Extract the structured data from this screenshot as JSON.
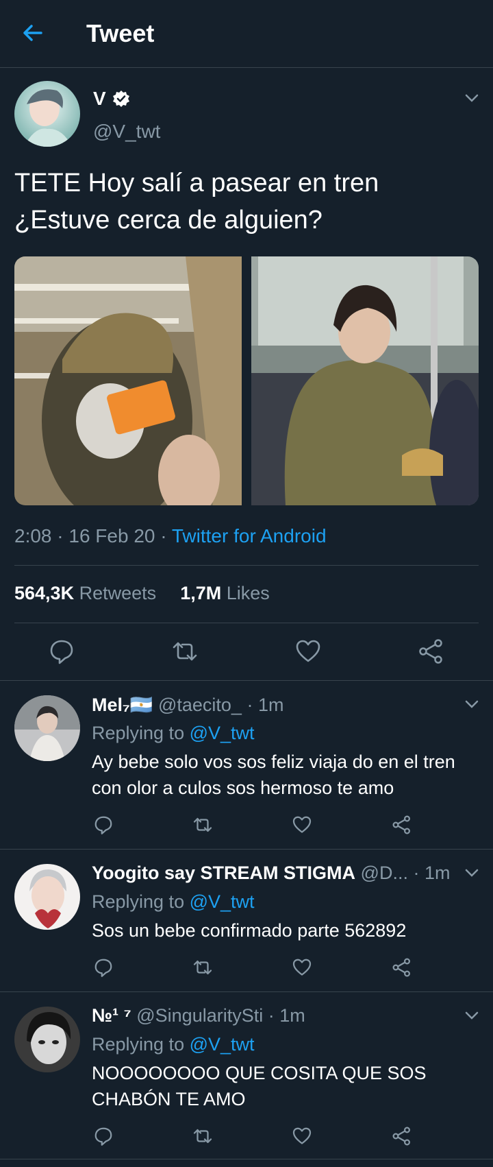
{
  "header": {
    "title": "Tweet"
  },
  "tweet": {
    "name": "V",
    "handle": "@V_twt",
    "text_line1": "TETE Hoy salí a pasear en tren",
    "text_line2": "¿Estuve cerca de alguien?",
    "time": "2:08 · 16 Feb 20 · ",
    "source": "Twitter for Android",
    "retweets_count": "564,3K",
    "retweets_label": "Retweets",
    "likes_count": "1,7M",
    "likes_label": "Likes"
  },
  "replies": [
    {
      "name": "Mel₇🇦🇷",
      "handle": "@taecito_",
      "time": "· 1m",
      "replying_label": "Replying to",
      "replying_to": "@V_twt",
      "text_line1": "Ay bebe solo vos sos feliz viaja do en el tren",
      "text_line2": "con olor a culos sos hermoso te amo"
    },
    {
      "name": "Yoogito say STREAM STIGMA",
      "handle": "@D...",
      "time": "· 1m",
      "replying_label": "Replying to",
      "replying_to": "@V_twt",
      "text_line1": "Sos un bebe confirmado parte 562892",
      "text_line2": ""
    },
    {
      "name": "№¹ ⁷",
      "handle": "@SingularitySti",
      "time": "· 1m",
      "replying_label": "Replying to",
      "replying_to": "@V_twt",
      "text_line1": "NOOOOOOOO QUE COSITA QUE SOS",
      "text_line2": "CHABÓN TE AMO"
    }
  ],
  "colors": {
    "background": "#15202b",
    "accent": "#1da1f2",
    "muted": "#8899a6",
    "divider": "#38444d"
  }
}
